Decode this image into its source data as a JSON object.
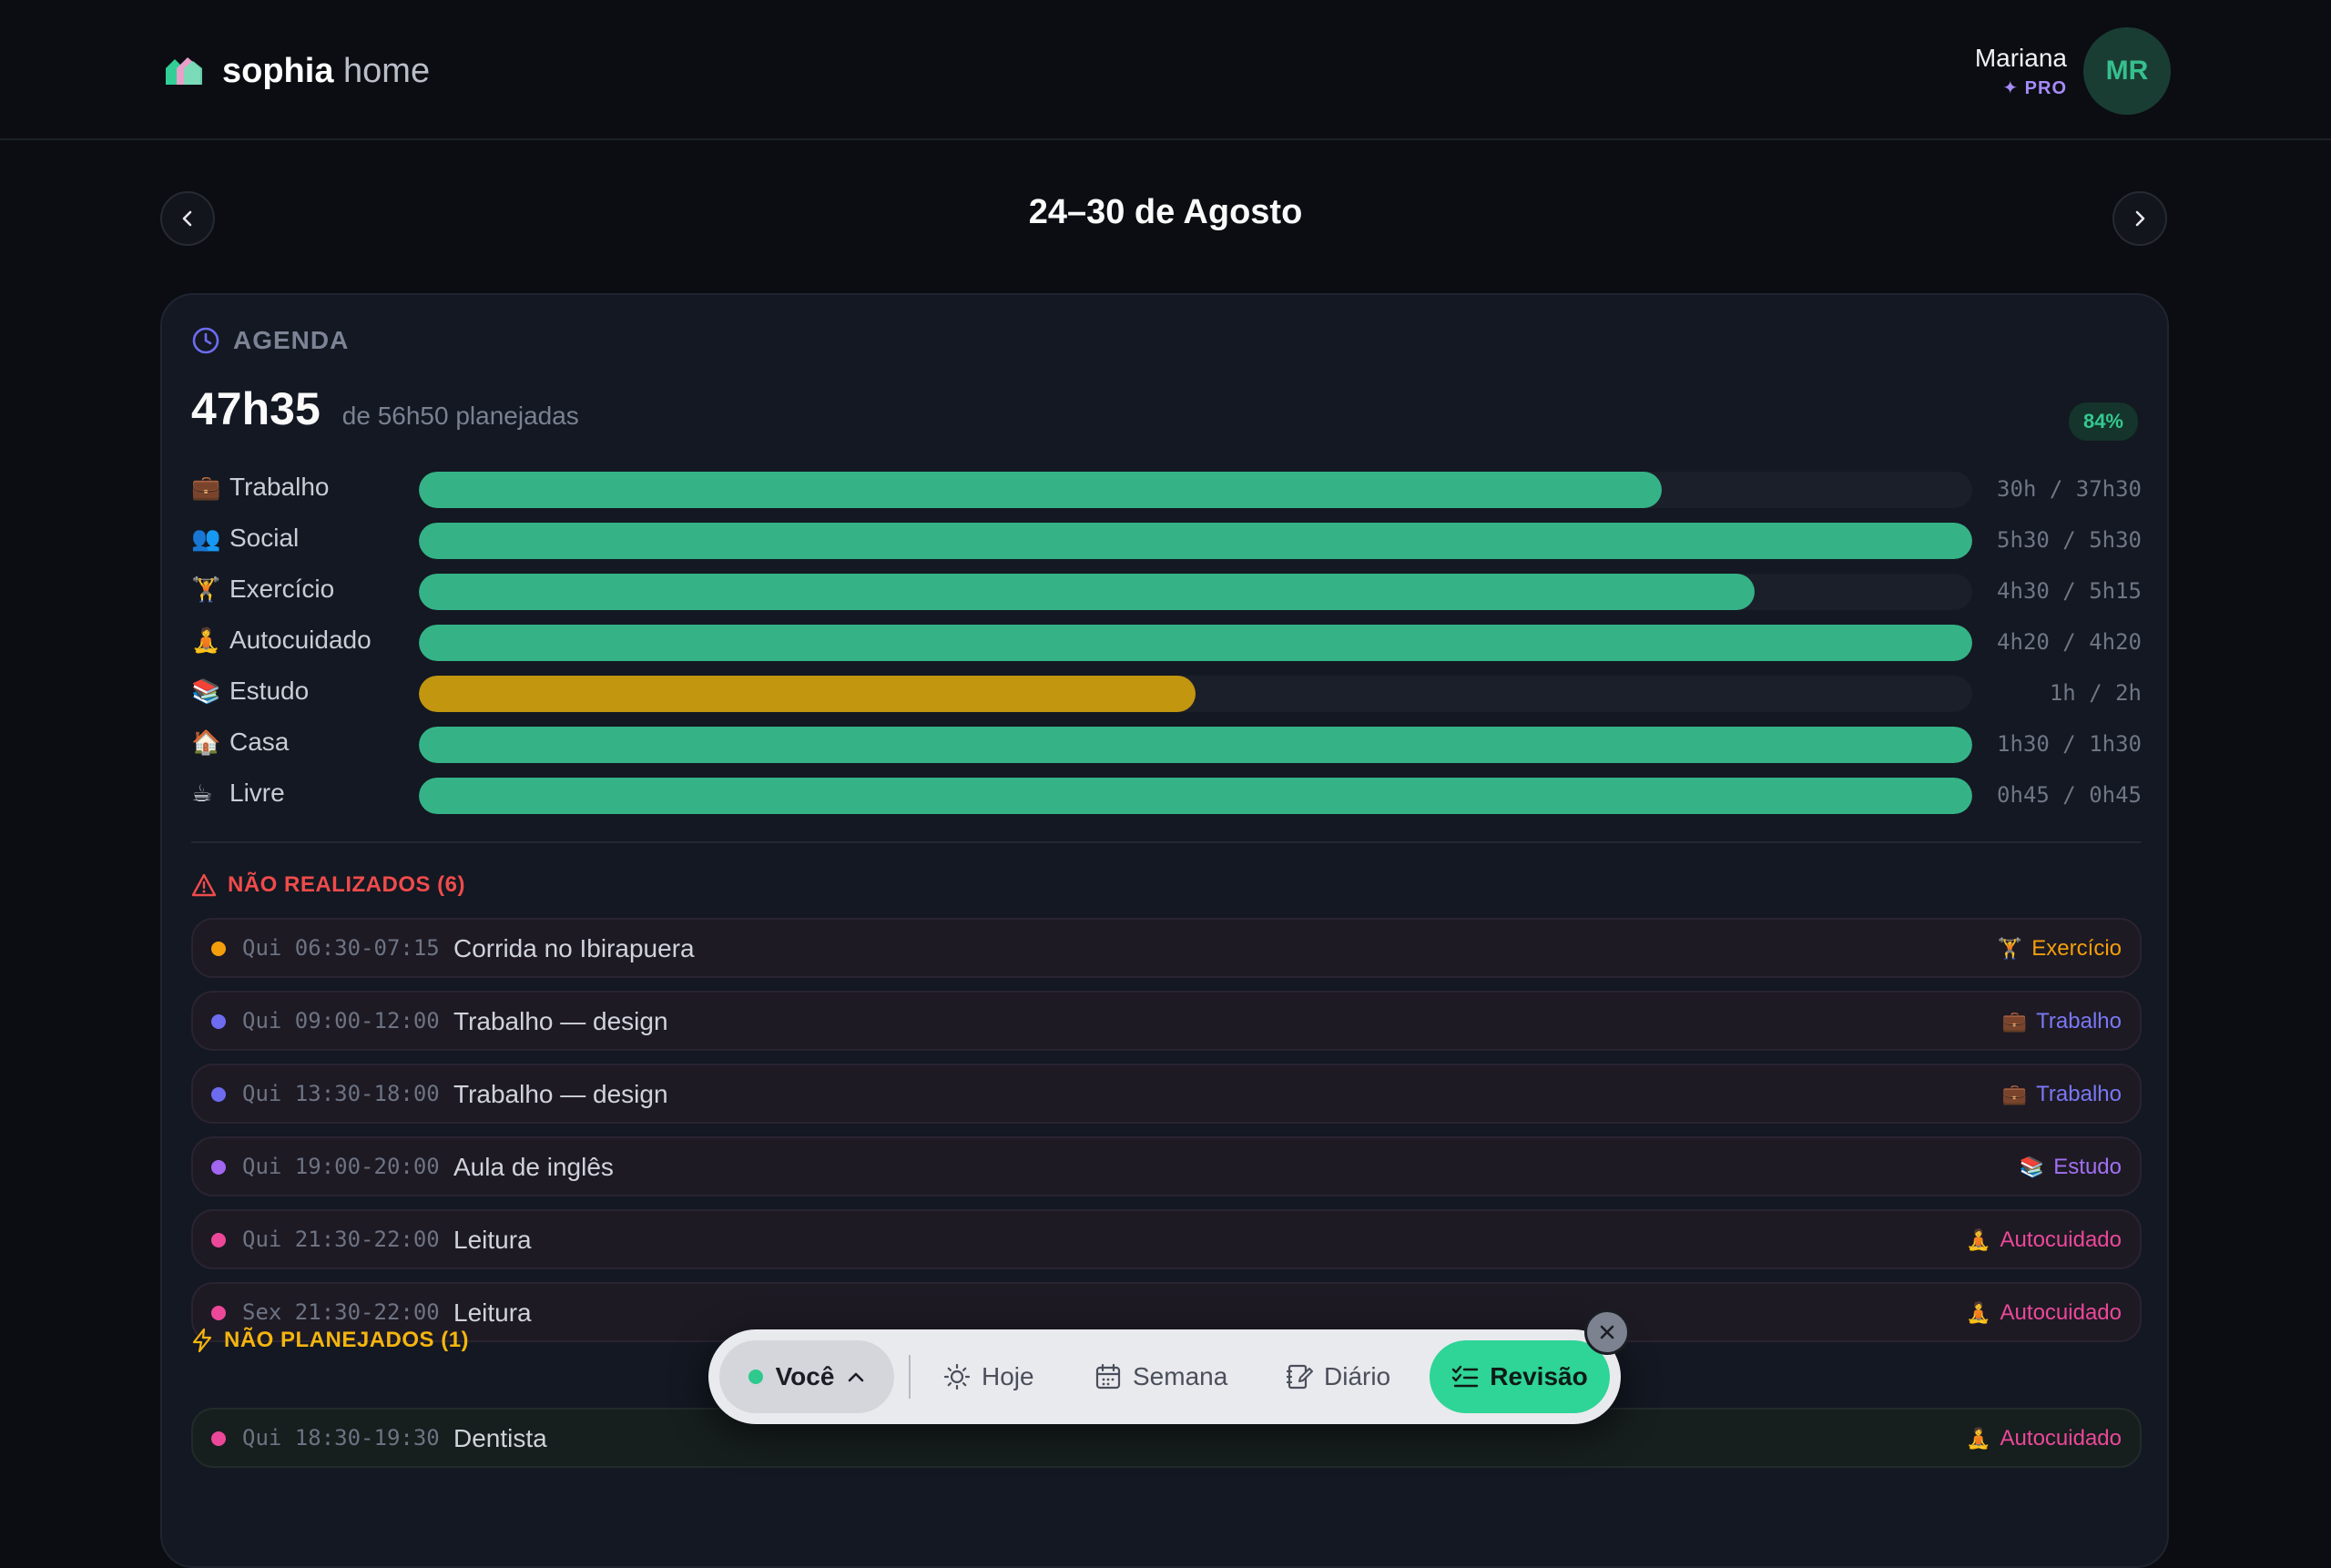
{
  "header": {
    "brand_bold": "sophia",
    "brand_light": " home",
    "user_name": "Mariana",
    "user_plan": "✦ PRO",
    "avatar_initials": "MR"
  },
  "week": {
    "title": "24–30 de Agosto"
  },
  "agenda": {
    "label": "AGENDA",
    "total": "47h35",
    "planned": "de 56h50 planejadas",
    "percent": "84%",
    "categories": [
      {
        "emoji": "💼",
        "name": "Trabalho",
        "value": "30h / 37h30",
        "fraction": 0.8,
        "color": "#35b386"
      },
      {
        "emoji": "👥",
        "name": "Social",
        "value": "5h30 / 5h30",
        "fraction": 1.0,
        "color": "#35b386"
      },
      {
        "emoji": "🏋",
        "name": "Exercício",
        "value": "4h30 / 5h15",
        "fraction": 0.86,
        "color": "#35b386"
      },
      {
        "emoji": "🧘",
        "name": "Autocuidado",
        "value": "4h20 / 4h20",
        "fraction": 1.0,
        "color": "#35b386"
      },
      {
        "emoji": "📚",
        "name": "Estudo",
        "value": "1h / 2h",
        "fraction": 0.5,
        "color": "#c2960f"
      },
      {
        "emoji": "🏠",
        "name": "Casa",
        "value": "1h30 / 1h30",
        "fraction": 1.0,
        "color": "#35b386"
      },
      {
        "emoji": "☕",
        "name": "Livre",
        "value": "0h45 / 0h45",
        "fraction": 1.0,
        "color": "#35b386"
      }
    ]
  },
  "not_done": {
    "label": "NÃO REALIZADOS (6)",
    "color": "#ef4b4b",
    "items": [
      {
        "dot": "#f59e0b",
        "time": "Qui 06:30-07:15",
        "title": "Corrida no Ibirapuera",
        "emoji": "🏋",
        "tag": "Exercício",
        "tag_color": "#f59e0b"
      },
      {
        "dot": "#6d6cf0",
        "time": "Qui 09:00-12:00",
        "title": "Trabalho — design",
        "emoji": "💼",
        "tag": "Trabalho",
        "tag_color": "#7a78f5"
      },
      {
        "dot": "#6d6cf0",
        "time": "Qui 13:30-18:00",
        "title": "Trabalho — design",
        "emoji": "💼",
        "tag": "Trabalho",
        "tag_color": "#7a78f5"
      },
      {
        "dot": "#a266f0",
        "time": "Qui 19:00-20:00",
        "title": "Aula de inglês",
        "emoji": "📚",
        "tag": "Estudo",
        "tag_color": "#a270f2"
      },
      {
        "dot": "#ec4899",
        "time": "Qui 21:30-22:00",
        "title": "Leitura",
        "emoji": "🧘",
        "tag": "Autocuidado",
        "tag_color": "#ec4899"
      },
      {
        "dot": "#ec4899",
        "time": "Sex 21:30-22:00",
        "title": "Leitura",
        "emoji": "🧘",
        "tag": "Autocuidado",
        "tag_color": "#ec4899"
      }
    ]
  },
  "unplanned": {
    "label": "NÃO PLANEJADOS (1)",
    "color": "#f5b50f",
    "items": [
      {
        "dot": "#ec4899",
        "time": "Qui 18:30-19:30",
        "title": "Dentista",
        "emoji": "🧘",
        "tag": "Autocuidado",
        "tag_color": "#ec4899"
      }
    ]
  },
  "dock": {
    "profile": "Você",
    "today": "Hoje",
    "week": "Semana",
    "journal": "Diário",
    "review": "Revisão"
  }
}
